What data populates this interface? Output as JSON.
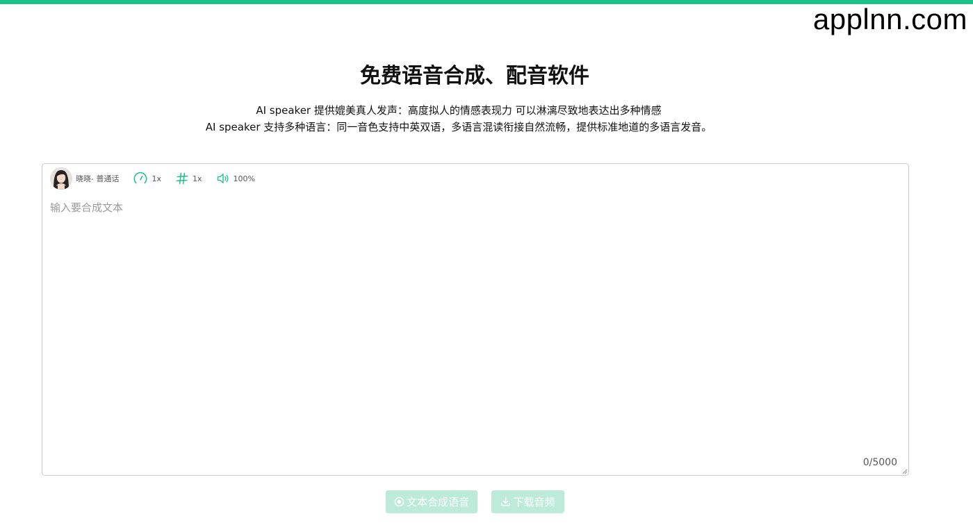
{
  "watermark": "applnn.com",
  "header": {
    "title": "免费语音合成、配音软件",
    "subtitle_line1": "AI speaker 提供媲美真人发声：高度拟人的情感表现力 可以淋漓尽致地表达出多种情感",
    "subtitle_line2": "AI speaker 支持多种语言：同一音色支持中英双语，多语言混读衔接自然流畅，提供标准地道的多语言发音。"
  },
  "toolbar": {
    "voice_label": "晓晓- 普通话",
    "speed_value": "1x",
    "pitch_value": "1x",
    "volume_value": "100%"
  },
  "editor": {
    "placeholder": "输入要合成文本",
    "value": "",
    "counter": "0/5000"
  },
  "buttons": {
    "synthesize_label": "文本合成语音",
    "download_label": "下载音频"
  },
  "colors": {
    "accent": "#1fbf8a",
    "button_disabled": "#bcebd9"
  }
}
